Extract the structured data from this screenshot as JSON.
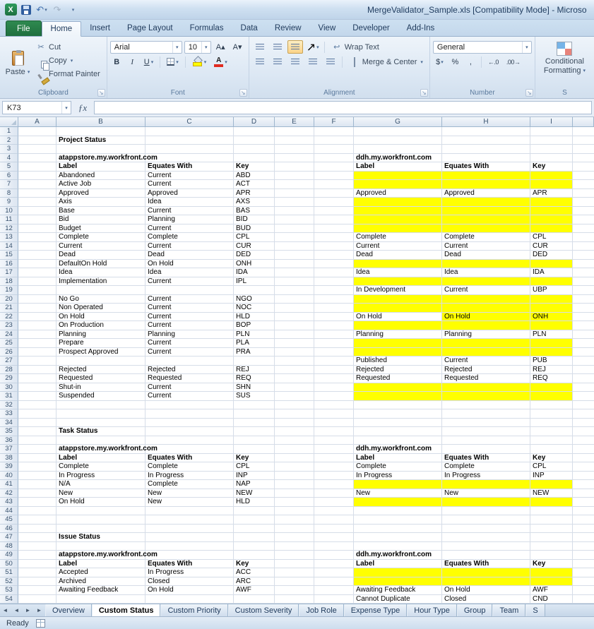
{
  "window": {
    "title": "MergeValidator_Sample.xls  [Compatibility Mode]  -  Microso"
  },
  "icons": {
    "excel_x": "X",
    "undo": "↶",
    "redo": "↷",
    "dropdown": "▾",
    "qat_customize": "▾",
    "cut": "✂",
    "bold": "B",
    "italic": "I",
    "underline": "U",
    "grow_font": "A▴",
    "shrink_font": "A▾",
    "orientation": "↗",
    "wrap_arrow": "↩",
    "currency": "$",
    "percent": "%",
    "comma": ",",
    "increase_decimal": "←.0",
    "decrease_decimal": ".00→",
    "fx": "ƒx",
    "launcher": "↘",
    "nav_first": "◄",
    "nav_prev": "◄",
    "nav_next": "►",
    "nav_last": "►"
  },
  "ribbon": {
    "file_tab": "File",
    "tabs": [
      "Home",
      "Insert",
      "Page Layout",
      "Formulas",
      "Data",
      "Review",
      "View",
      "Developer",
      "Add-Ins"
    ],
    "active_tab": "Home",
    "clipboard": {
      "label": "Clipboard",
      "paste": "Paste",
      "cut": "Cut",
      "copy": "Copy",
      "format_painter": "Format Painter"
    },
    "font": {
      "label": "Font",
      "font_name": "Arial",
      "font_size": "10"
    },
    "alignment": {
      "label": "Alignment",
      "wrap_text": "Wrap Text",
      "merge_center": "Merge & Center"
    },
    "number": {
      "label": "Number",
      "format": "General"
    },
    "styles": {
      "label": "S",
      "conditional_line1": "Conditional",
      "conditional_line2": "Formatting"
    }
  },
  "formula_bar": {
    "name_box": "K73",
    "formula": ""
  },
  "sheet": {
    "columns": [
      "A",
      "B",
      "C",
      "D",
      "E",
      "F",
      "G",
      "H",
      "I"
    ],
    "visible_rows": 54,
    "highlight_color": "#ffff00",
    "cells": [
      [
        2,
        "B",
        "Project Status",
        "b"
      ],
      [
        4,
        "B",
        "atappstore.my.workfront.com",
        "b"
      ],
      [
        4,
        "G",
        "ddh.my.workfront.com",
        "b"
      ],
      [
        5,
        "B",
        "Label",
        "b"
      ],
      [
        5,
        "C",
        "Equates With",
        "b"
      ],
      [
        5,
        "D",
        "Key",
        "b"
      ],
      [
        5,
        "G",
        "Label",
        "b"
      ],
      [
        5,
        "H",
        "Equates With",
        "b"
      ],
      [
        5,
        "I",
        "Key",
        "b"
      ],
      [
        6,
        "B",
        "Abandoned"
      ],
      [
        6,
        "C",
        "Current"
      ],
      [
        6,
        "D",
        "ABD"
      ],
      [
        6,
        "G",
        "",
        "y"
      ],
      [
        6,
        "H",
        "",
        "y"
      ],
      [
        6,
        "I",
        "",
        "y"
      ],
      [
        7,
        "B",
        "Active Job"
      ],
      [
        7,
        "C",
        "Current"
      ],
      [
        7,
        "D",
        "ACT"
      ],
      [
        7,
        "G",
        "",
        "y"
      ],
      [
        7,
        "H",
        "",
        "y"
      ],
      [
        7,
        "I",
        "",
        "y"
      ],
      [
        8,
        "B",
        "Approved"
      ],
      [
        8,
        "C",
        "Approved"
      ],
      [
        8,
        "D",
        "APR"
      ],
      [
        8,
        "G",
        "Approved"
      ],
      [
        8,
        "H",
        "Approved"
      ],
      [
        8,
        "I",
        "APR"
      ],
      [
        9,
        "B",
        "Axis"
      ],
      [
        9,
        "C",
        "Idea"
      ],
      [
        9,
        "D",
        "AXS"
      ],
      [
        9,
        "G",
        "",
        "y"
      ],
      [
        9,
        "H",
        "",
        "y"
      ],
      [
        9,
        "I",
        "",
        "y"
      ],
      [
        10,
        "B",
        "Base"
      ],
      [
        10,
        "C",
        "Current"
      ],
      [
        10,
        "D",
        "BAS"
      ],
      [
        10,
        "G",
        "",
        "y"
      ],
      [
        10,
        "H",
        "",
        "y"
      ],
      [
        10,
        "I",
        "",
        "y"
      ],
      [
        11,
        "B",
        "Bid"
      ],
      [
        11,
        "C",
        "Planning"
      ],
      [
        11,
        "D",
        "BID"
      ],
      [
        11,
        "G",
        "",
        "y"
      ],
      [
        11,
        "H",
        "",
        "y"
      ],
      [
        11,
        "I",
        "",
        "y"
      ],
      [
        12,
        "B",
        "Budget"
      ],
      [
        12,
        "C",
        "Current"
      ],
      [
        12,
        "D",
        "BUD"
      ],
      [
        12,
        "G",
        "",
        "y"
      ],
      [
        12,
        "H",
        "",
        "y"
      ],
      [
        12,
        "I",
        "",
        "y"
      ],
      [
        13,
        "B",
        "Complete"
      ],
      [
        13,
        "C",
        "Complete"
      ],
      [
        13,
        "D",
        "CPL"
      ],
      [
        13,
        "G",
        "Complete"
      ],
      [
        13,
        "H",
        "Complete"
      ],
      [
        13,
        "I",
        "CPL"
      ],
      [
        14,
        "B",
        "Current"
      ],
      [
        14,
        "C",
        "Current"
      ],
      [
        14,
        "D",
        "CUR"
      ],
      [
        14,
        "G",
        "Current"
      ],
      [
        14,
        "H",
        "Current"
      ],
      [
        14,
        "I",
        "CUR"
      ],
      [
        15,
        "B",
        "Dead"
      ],
      [
        15,
        "C",
        "Dead"
      ],
      [
        15,
        "D",
        "DED"
      ],
      [
        15,
        "G",
        "Dead"
      ],
      [
        15,
        "H",
        "Dead"
      ],
      [
        15,
        "I",
        "DED"
      ],
      [
        16,
        "B",
        "DefaultOn Hold"
      ],
      [
        16,
        "C",
        "On Hold"
      ],
      [
        16,
        "D",
        "ONH"
      ],
      [
        16,
        "G",
        "",
        "y"
      ],
      [
        16,
        "H",
        "",
        "y"
      ],
      [
        16,
        "I",
        "",
        "y"
      ],
      [
        17,
        "B",
        "Idea"
      ],
      [
        17,
        "C",
        "Idea"
      ],
      [
        17,
        "D",
        "IDA"
      ],
      [
        17,
        "G",
        "Idea"
      ],
      [
        17,
        "H",
        "Idea"
      ],
      [
        17,
        "I",
        "IDA"
      ],
      [
        18,
        "B",
        "Implementation"
      ],
      [
        18,
        "C",
        "Current"
      ],
      [
        18,
        "D",
        "IPL"
      ],
      [
        18,
        "G",
        "",
        "y"
      ],
      [
        18,
        "H",
        "",
        "y"
      ],
      [
        18,
        "I",
        "",
        "y"
      ],
      [
        19,
        "G",
        "In Development"
      ],
      [
        19,
        "H",
        "Current"
      ],
      [
        19,
        "I",
        "UBP"
      ],
      [
        20,
        "B",
        "No Go"
      ],
      [
        20,
        "C",
        "Current"
      ],
      [
        20,
        "D",
        "NGO"
      ],
      [
        20,
        "G",
        "",
        "y"
      ],
      [
        20,
        "H",
        "",
        "y"
      ],
      [
        20,
        "I",
        "",
        "y"
      ],
      [
        21,
        "B",
        "Non Operated"
      ],
      [
        21,
        "C",
        "Current"
      ],
      [
        21,
        "D",
        "NOC"
      ],
      [
        21,
        "G",
        "",
        "y"
      ],
      [
        21,
        "H",
        "",
        "y"
      ],
      [
        21,
        "I",
        "",
        "y"
      ],
      [
        22,
        "B",
        "On Hold"
      ],
      [
        22,
        "C",
        "Current"
      ],
      [
        22,
        "D",
        "HLD"
      ],
      [
        22,
        "G",
        "On Hold"
      ],
      [
        22,
        "H",
        "On Hold",
        "y"
      ],
      [
        22,
        "I",
        "ONH",
        "y"
      ],
      [
        23,
        "B",
        "On Production"
      ],
      [
        23,
        "C",
        "Current"
      ],
      [
        23,
        "D",
        "BOP"
      ],
      [
        23,
        "G",
        "",
        "y"
      ],
      [
        23,
        "H",
        "",
        "y"
      ],
      [
        23,
        "I",
        "",
        "y"
      ],
      [
        24,
        "B",
        "Planning"
      ],
      [
        24,
        "C",
        "Planning"
      ],
      [
        24,
        "D",
        "PLN"
      ],
      [
        24,
        "G",
        "Planning"
      ],
      [
        24,
        "H",
        "Planning"
      ],
      [
        24,
        "I",
        "PLN"
      ],
      [
        25,
        "B",
        "Prepare"
      ],
      [
        25,
        "C",
        "Current"
      ],
      [
        25,
        "D",
        "PLA"
      ],
      [
        25,
        "G",
        "",
        "y"
      ],
      [
        25,
        "H",
        "",
        "y"
      ],
      [
        25,
        "I",
        "",
        "y"
      ],
      [
        26,
        "B",
        "Prospect Approved"
      ],
      [
        26,
        "C",
        "Current"
      ],
      [
        26,
        "D",
        "PRA"
      ],
      [
        26,
        "G",
        "",
        "y"
      ],
      [
        26,
        "H",
        "",
        "y"
      ],
      [
        26,
        "I",
        "",
        "y"
      ],
      [
        27,
        "G",
        "Published"
      ],
      [
        27,
        "H",
        "Current"
      ],
      [
        27,
        "I",
        "PUB"
      ],
      [
        28,
        "B",
        "Rejected"
      ],
      [
        28,
        "C",
        "Rejected"
      ],
      [
        28,
        "D",
        "REJ"
      ],
      [
        28,
        "G",
        "Rejected"
      ],
      [
        28,
        "H",
        "Rejected"
      ],
      [
        28,
        "I",
        "REJ"
      ],
      [
        29,
        "B",
        "Requested"
      ],
      [
        29,
        "C",
        "Requested"
      ],
      [
        29,
        "D",
        "REQ"
      ],
      [
        29,
        "G",
        "Requested"
      ],
      [
        29,
        "H",
        "Requested"
      ],
      [
        29,
        "I",
        "REQ"
      ],
      [
        30,
        "B",
        "Shut-in"
      ],
      [
        30,
        "C",
        "Current"
      ],
      [
        30,
        "D",
        "SHN"
      ],
      [
        30,
        "G",
        "",
        "y"
      ],
      [
        30,
        "H",
        "",
        "y"
      ],
      [
        30,
        "I",
        "",
        "y"
      ],
      [
        31,
        "B",
        "Suspended"
      ],
      [
        31,
        "C",
        "Current"
      ],
      [
        31,
        "D",
        "SUS"
      ],
      [
        31,
        "G",
        "",
        "y"
      ],
      [
        31,
        "H",
        "",
        "y"
      ],
      [
        31,
        "I",
        "",
        "y"
      ],
      [
        35,
        "B",
        "Task Status",
        "b"
      ],
      [
        37,
        "B",
        "atappstore.my.workfront.com",
        "b"
      ],
      [
        37,
        "G",
        "ddh.my.workfront.com",
        "b"
      ],
      [
        38,
        "B",
        "Label",
        "b"
      ],
      [
        38,
        "C",
        "Equates With",
        "b"
      ],
      [
        38,
        "D",
        "Key",
        "b"
      ],
      [
        38,
        "G",
        "Label",
        "b"
      ],
      [
        38,
        "H",
        "Equates With",
        "b"
      ],
      [
        38,
        "I",
        "Key",
        "b"
      ],
      [
        39,
        "B",
        "Complete"
      ],
      [
        39,
        "C",
        "Complete"
      ],
      [
        39,
        "D",
        "CPL"
      ],
      [
        39,
        "G",
        "Complete"
      ],
      [
        39,
        "H",
        "Complete"
      ],
      [
        39,
        "I",
        "CPL"
      ],
      [
        40,
        "B",
        "In Progress"
      ],
      [
        40,
        "C",
        "In Progress"
      ],
      [
        40,
        "D",
        "INP"
      ],
      [
        40,
        "G",
        "In Progress"
      ],
      [
        40,
        "H",
        "In Progress"
      ],
      [
        40,
        "I",
        "INP"
      ],
      [
        41,
        "B",
        "N/A"
      ],
      [
        41,
        "C",
        "Complete"
      ],
      [
        41,
        "D",
        "NAP"
      ],
      [
        41,
        "G",
        "",
        "y"
      ],
      [
        41,
        "H",
        "",
        "y"
      ],
      [
        41,
        "I",
        "",
        "y"
      ],
      [
        42,
        "B",
        "New"
      ],
      [
        42,
        "C",
        "New"
      ],
      [
        42,
        "D",
        "NEW"
      ],
      [
        42,
        "G",
        "New"
      ],
      [
        42,
        "H",
        "New"
      ],
      [
        42,
        "I",
        "NEW"
      ],
      [
        43,
        "B",
        "On Hold"
      ],
      [
        43,
        "C",
        "New"
      ],
      [
        43,
        "D",
        "HLD"
      ],
      [
        43,
        "G",
        "",
        "y"
      ],
      [
        43,
        "H",
        "",
        "y"
      ],
      [
        43,
        "I",
        "",
        "y"
      ],
      [
        47,
        "B",
        "Issue Status",
        "b"
      ],
      [
        49,
        "B",
        "atappstore.my.workfront.com",
        "b"
      ],
      [
        49,
        "G",
        "ddh.my.workfront.com",
        "b"
      ],
      [
        50,
        "B",
        "Label",
        "b"
      ],
      [
        50,
        "C",
        "Equates With",
        "b"
      ],
      [
        50,
        "D",
        "Key",
        "b"
      ],
      [
        50,
        "G",
        "Label",
        "b"
      ],
      [
        50,
        "H",
        "Equates With",
        "b"
      ],
      [
        50,
        "I",
        "Key",
        "b"
      ],
      [
        51,
        "B",
        "Accepted"
      ],
      [
        51,
        "C",
        "In Progress"
      ],
      [
        51,
        "D",
        "ACC"
      ],
      [
        51,
        "G",
        "",
        "y"
      ],
      [
        51,
        "H",
        "",
        "y"
      ],
      [
        51,
        "I",
        "",
        "y"
      ],
      [
        52,
        "B",
        "Archived"
      ],
      [
        52,
        "C",
        "Closed"
      ],
      [
        52,
        "D",
        "ARC"
      ],
      [
        52,
        "G",
        "",
        "y"
      ],
      [
        52,
        "H",
        "",
        "y"
      ],
      [
        52,
        "I",
        "",
        "y"
      ],
      [
        53,
        "B",
        "Awaiting Feedback"
      ],
      [
        53,
        "C",
        "On Hold"
      ],
      [
        53,
        "D",
        "AWF"
      ],
      [
        53,
        "G",
        "Awaiting Feedback"
      ],
      [
        53,
        "H",
        "On Hold"
      ],
      [
        53,
        "I",
        "AWF"
      ],
      [
        54,
        "G",
        "Cannot Duplicate"
      ],
      [
        54,
        "H",
        "Closed"
      ],
      [
        54,
        "I",
        "CND"
      ]
    ]
  },
  "sheet_tabs": {
    "tabs": [
      "Overview",
      "Custom Status",
      "Custom Priority",
      "Custom Severity",
      "Job Role",
      "Expense Type",
      "Hour Type",
      "Group",
      "Team",
      "S"
    ],
    "active": "Custom Status"
  },
  "status_bar": {
    "mode": "Ready"
  }
}
